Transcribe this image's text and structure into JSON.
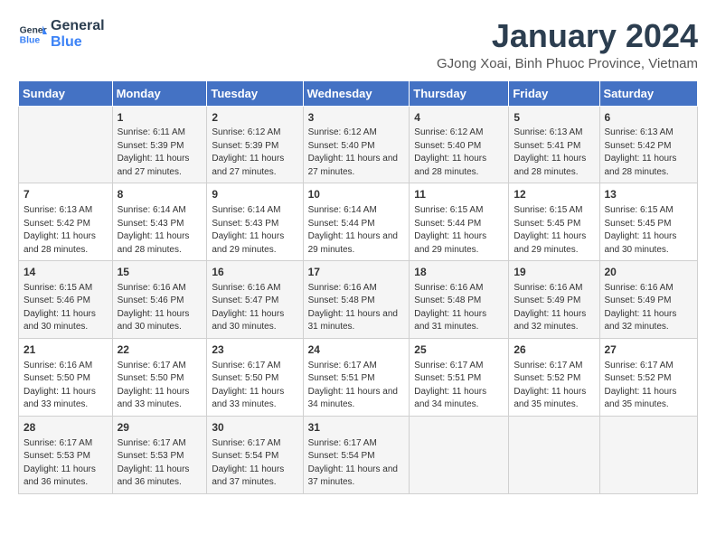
{
  "logo": {
    "line1": "General",
    "line2": "Blue"
  },
  "title": "January 2024",
  "location": "GJong Xoai, Binh Phuoc Province, Vietnam",
  "days_of_week": [
    "Sunday",
    "Monday",
    "Tuesday",
    "Wednesday",
    "Thursday",
    "Friday",
    "Saturday"
  ],
  "weeks": [
    [
      {
        "day": "",
        "sunrise": "",
        "sunset": "",
        "daylight": ""
      },
      {
        "day": "1",
        "sunrise": "Sunrise: 6:11 AM",
        "sunset": "Sunset: 5:39 PM",
        "daylight": "Daylight: 11 hours and 27 minutes."
      },
      {
        "day": "2",
        "sunrise": "Sunrise: 6:12 AM",
        "sunset": "Sunset: 5:39 PM",
        "daylight": "Daylight: 11 hours and 27 minutes."
      },
      {
        "day": "3",
        "sunrise": "Sunrise: 6:12 AM",
        "sunset": "Sunset: 5:40 PM",
        "daylight": "Daylight: 11 hours and 27 minutes."
      },
      {
        "day": "4",
        "sunrise": "Sunrise: 6:12 AM",
        "sunset": "Sunset: 5:40 PM",
        "daylight": "Daylight: 11 hours and 28 minutes."
      },
      {
        "day": "5",
        "sunrise": "Sunrise: 6:13 AM",
        "sunset": "Sunset: 5:41 PM",
        "daylight": "Daylight: 11 hours and 28 minutes."
      },
      {
        "day": "6",
        "sunrise": "Sunrise: 6:13 AM",
        "sunset": "Sunset: 5:42 PM",
        "daylight": "Daylight: 11 hours and 28 minutes."
      }
    ],
    [
      {
        "day": "7",
        "sunrise": "Sunrise: 6:13 AM",
        "sunset": "Sunset: 5:42 PM",
        "daylight": "Daylight: 11 hours and 28 minutes."
      },
      {
        "day": "8",
        "sunrise": "Sunrise: 6:14 AM",
        "sunset": "Sunset: 5:43 PM",
        "daylight": "Daylight: 11 hours and 28 minutes."
      },
      {
        "day": "9",
        "sunrise": "Sunrise: 6:14 AM",
        "sunset": "Sunset: 5:43 PM",
        "daylight": "Daylight: 11 hours and 29 minutes."
      },
      {
        "day": "10",
        "sunrise": "Sunrise: 6:14 AM",
        "sunset": "Sunset: 5:44 PM",
        "daylight": "Daylight: 11 hours and 29 minutes."
      },
      {
        "day": "11",
        "sunrise": "Sunrise: 6:15 AM",
        "sunset": "Sunset: 5:44 PM",
        "daylight": "Daylight: 11 hours and 29 minutes."
      },
      {
        "day": "12",
        "sunrise": "Sunrise: 6:15 AM",
        "sunset": "Sunset: 5:45 PM",
        "daylight": "Daylight: 11 hours and 29 minutes."
      },
      {
        "day": "13",
        "sunrise": "Sunrise: 6:15 AM",
        "sunset": "Sunset: 5:45 PM",
        "daylight": "Daylight: 11 hours and 30 minutes."
      }
    ],
    [
      {
        "day": "14",
        "sunrise": "Sunrise: 6:15 AM",
        "sunset": "Sunset: 5:46 PM",
        "daylight": "Daylight: 11 hours and 30 minutes."
      },
      {
        "day": "15",
        "sunrise": "Sunrise: 6:16 AM",
        "sunset": "Sunset: 5:46 PM",
        "daylight": "Daylight: 11 hours and 30 minutes."
      },
      {
        "day": "16",
        "sunrise": "Sunrise: 6:16 AM",
        "sunset": "Sunset: 5:47 PM",
        "daylight": "Daylight: 11 hours and 30 minutes."
      },
      {
        "day": "17",
        "sunrise": "Sunrise: 6:16 AM",
        "sunset": "Sunset: 5:48 PM",
        "daylight": "Daylight: 11 hours and 31 minutes."
      },
      {
        "day": "18",
        "sunrise": "Sunrise: 6:16 AM",
        "sunset": "Sunset: 5:48 PM",
        "daylight": "Daylight: 11 hours and 31 minutes."
      },
      {
        "day": "19",
        "sunrise": "Sunrise: 6:16 AM",
        "sunset": "Sunset: 5:49 PM",
        "daylight": "Daylight: 11 hours and 32 minutes."
      },
      {
        "day": "20",
        "sunrise": "Sunrise: 6:16 AM",
        "sunset": "Sunset: 5:49 PM",
        "daylight": "Daylight: 11 hours and 32 minutes."
      }
    ],
    [
      {
        "day": "21",
        "sunrise": "Sunrise: 6:16 AM",
        "sunset": "Sunset: 5:50 PM",
        "daylight": "Daylight: 11 hours and 33 minutes."
      },
      {
        "day": "22",
        "sunrise": "Sunrise: 6:17 AM",
        "sunset": "Sunset: 5:50 PM",
        "daylight": "Daylight: 11 hours and 33 minutes."
      },
      {
        "day": "23",
        "sunrise": "Sunrise: 6:17 AM",
        "sunset": "Sunset: 5:50 PM",
        "daylight": "Daylight: 11 hours and 33 minutes."
      },
      {
        "day": "24",
        "sunrise": "Sunrise: 6:17 AM",
        "sunset": "Sunset: 5:51 PM",
        "daylight": "Daylight: 11 hours and 34 minutes."
      },
      {
        "day": "25",
        "sunrise": "Sunrise: 6:17 AM",
        "sunset": "Sunset: 5:51 PM",
        "daylight": "Daylight: 11 hours and 34 minutes."
      },
      {
        "day": "26",
        "sunrise": "Sunrise: 6:17 AM",
        "sunset": "Sunset: 5:52 PM",
        "daylight": "Daylight: 11 hours and 35 minutes."
      },
      {
        "day": "27",
        "sunrise": "Sunrise: 6:17 AM",
        "sunset": "Sunset: 5:52 PM",
        "daylight": "Daylight: 11 hours and 35 minutes."
      }
    ],
    [
      {
        "day": "28",
        "sunrise": "Sunrise: 6:17 AM",
        "sunset": "Sunset: 5:53 PM",
        "daylight": "Daylight: 11 hours and 36 minutes."
      },
      {
        "day": "29",
        "sunrise": "Sunrise: 6:17 AM",
        "sunset": "Sunset: 5:53 PM",
        "daylight": "Daylight: 11 hours and 36 minutes."
      },
      {
        "day": "30",
        "sunrise": "Sunrise: 6:17 AM",
        "sunset": "Sunset: 5:54 PM",
        "daylight": "Daylight: 11 hours and 37 minutes."
      },
      {
        "day": "31",
        "sunrise": "Sunrise: 6:17 AM",
        "sunset": "Sunset: 5:54 PM",
        "daylight": "Daylight: 11 hours and 37 minutes."
      },
      {
        "day": "",
        "sunrise": "",
        "sunset": "",
        "daylight": ""
      },
      {
        "day": "",
        "sunrise": "",
        "sunset": "",
        "daylight": ""
      },
      {
        "day": "",
        "sunrise": "",
        "sunset": "",
        "daylight": ""
      }
    ]
  ]
}
